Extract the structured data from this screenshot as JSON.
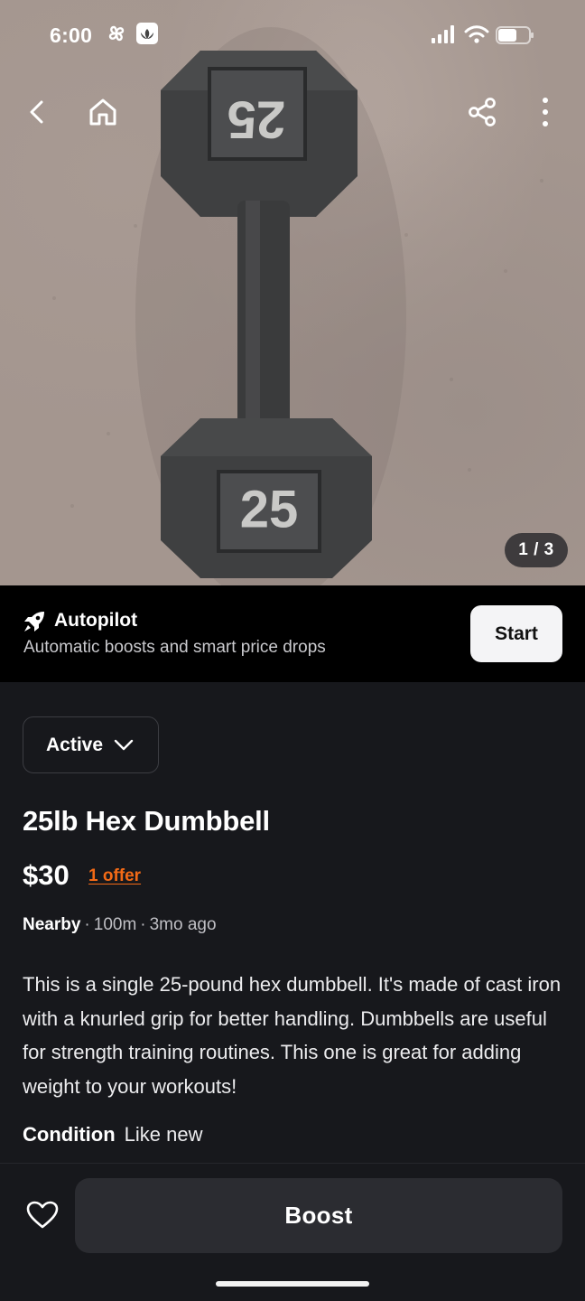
{
  "status_bar": {
    "time": "6:00",
    "icons": [
      "pinwheel-icon",
      "lotus-app-icon",
      "signal-icon",
      "wifi-icon",
      "battery-icon"
    ]
  },
  "nav": {
    "icons": [
      "back-icon",
      "home-icon",
      "share-icon",
      "more-icon"
    ]
  },
  "photo": {
    "weight_label_top": "25",
    "weight_label_bottom": "25",
    "counter": "1 / 3",
    "background_color": "#a4968f"
  },
  "autopilot": {
    "title": "Autopilot",
    "subtitle": "Automatic boosts and smart price drops",
    "button_label": "Start",
    "icon": "rocket-icon"
  },
  "listing": {
    "status_label": "Active",
    "title": "25lb Hex Dumbbell",
    "price": "$30",
    "offer_link": "1 offer",
    "location": "Nearby",
    "distance": "100m",
    "posted": "3mo ago",
    "description": "This is a single 25-pound hex dumbbell. It's made of cast iron with a knurled grip for better handling. Dumbbells are useful for strength training routines. This one is great for adding weight to your workouts!",
    "condition_label": "Condition",
    "condition_value": "Like new"
  },
  "bottom_bar": {
    "boost_label": "Boost",
    "favorite_icon": "heart-icon"
  },
  "colors": {
    "background": "#17181c",
    "banner": "#000000",
    "accent_offer": "#f36a16",
    "button_dark": "#2b2c31",
    "button_light": "#f4f4f6"
  }
}
